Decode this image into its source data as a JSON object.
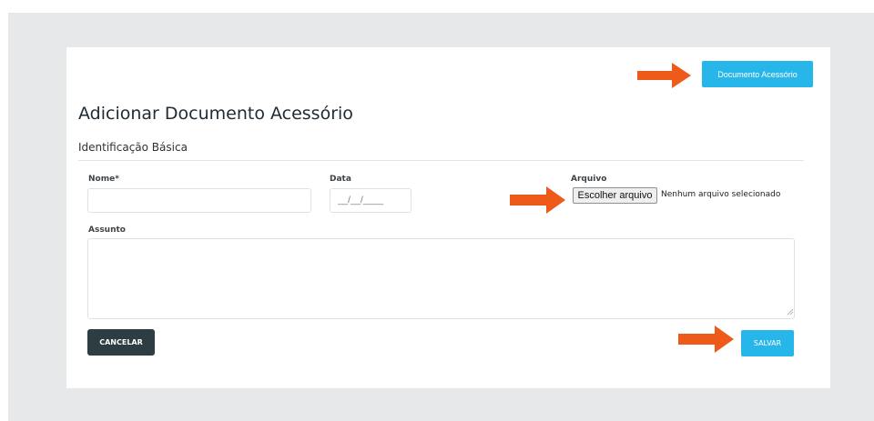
{
  "top_bar": {
    "accessory_doc_button": "Documento Acessório"
  },
  "page": {
    "title": "Adicionar Documento Acessório"
  },
  "section": {
    "title": "Identificação Básica"
  },
  "form": {
    "nome": {
      "label": "Nome*",
      "value": ""
    },
    "data": {
      "label": "Data",
      "placeholder": "__/__/____"
    },
    "arquivo": {
      "label": "Arquivo",
      "button": "Escolher arquivo",
      "status": "Nenhum arquivo selecionado"
    },
    "assunto": {
      "label": "Assunto",
      "value": ""
    }
  },
  "actions": {
    "cancel": "CANCELAR",
    "save": "SALVAR"
  },
  "icons": {
    "annotation": "arrow-right-icon",
    "resize": "resize-grip-icon"
  },
  "colors": {
    "accent": "#27b6ea",
    "cancel": "#2e3d42",
    "annotation_arrow": "#ee5a1a",
    "backdrop": "#e7e8e9"
  }
}
